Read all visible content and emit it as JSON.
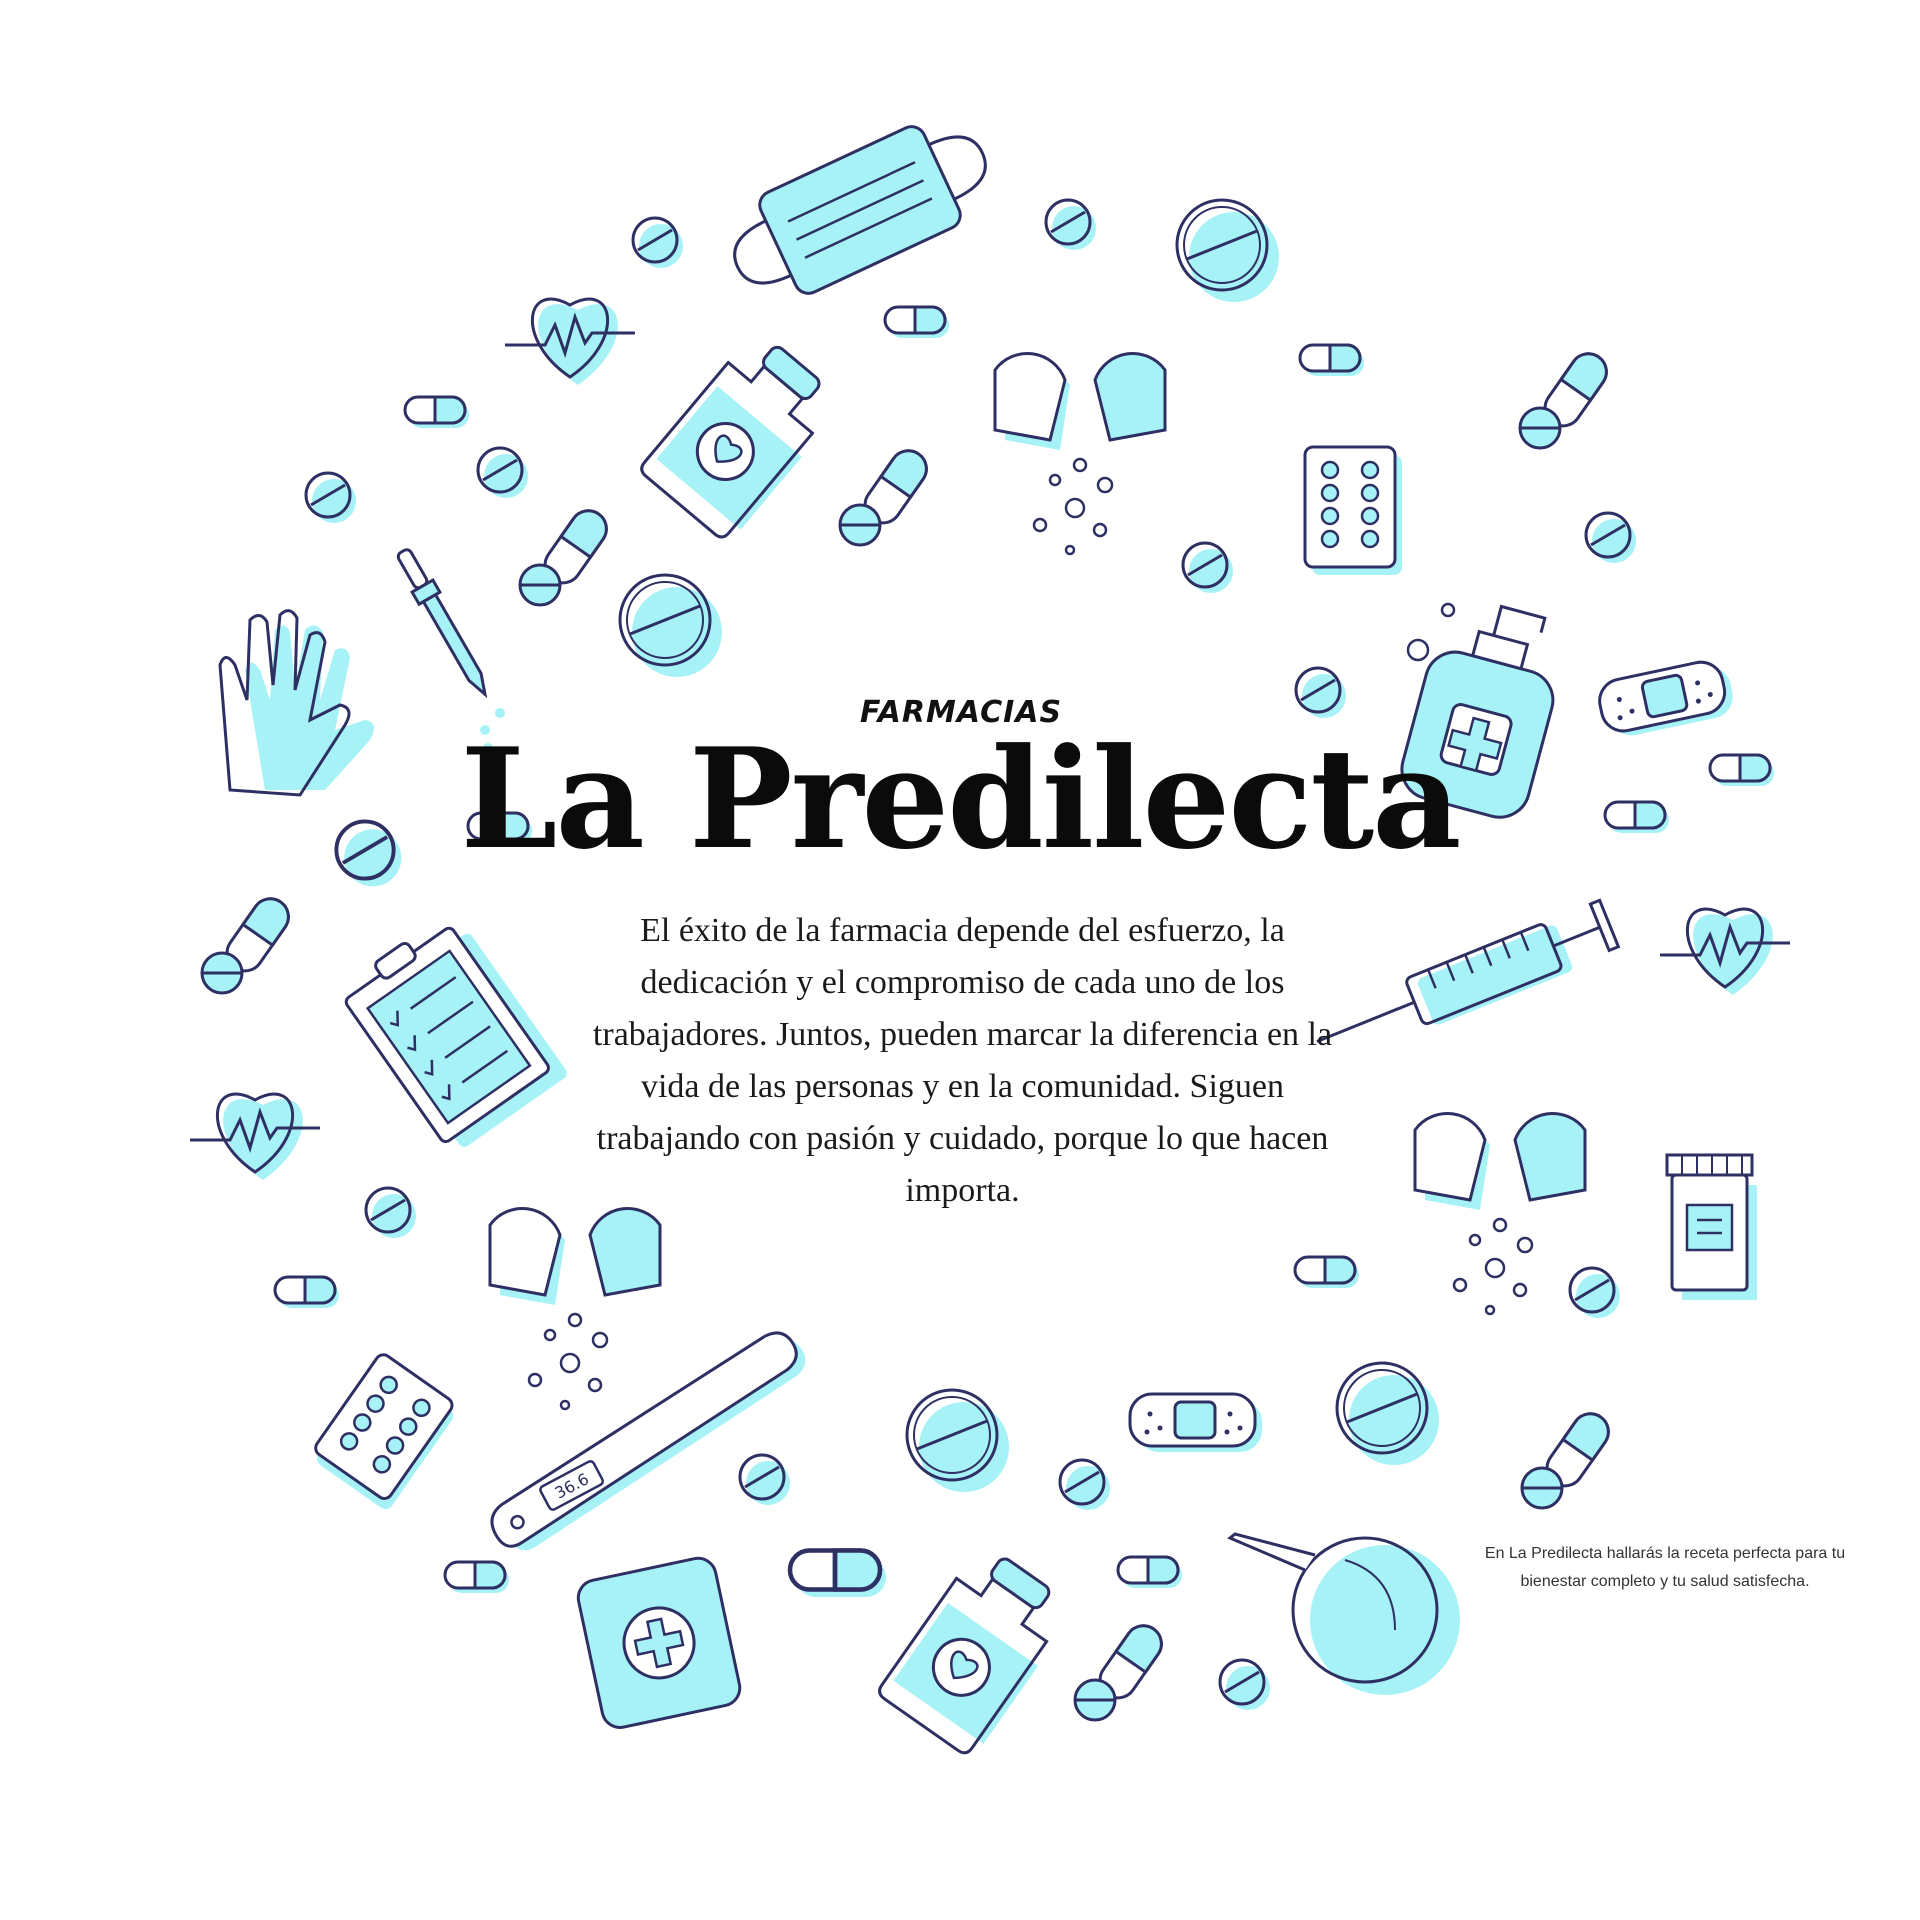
{
  "header": {
    "eyebrow": "FARMACIAS",
    "title": "La Predilecta"
  },
  "main": {
    "paragraph": "El éxito de la farmacia depende del esfuerzo, la dedicación y el compromiso de cada uno de los trabajadores. Juntos, pueden marcar la diferencia en la vida de las personas y en la comunidad. Siguen trabajando con pasión y cuidado, porque lo que hacen importa."
  },
  "footer": {
    "note": "En La Predilecta hallarás la receta perfecta para tu bienestar completo y tu salud satisfecha."
  },
  "illustration": {
    "thermometer_reading": "36.6",
    "icons": [
      "face-mask-icon",
      "heart-rate-icon",
      "medicine-bottle-icon",
      "open-capsule-icon",
      "blister-pack-icon",
      "capsule-icon",
      "tablet-icon",
      "dropper-icon",
      "gloves-icon",
      "hand-sanitizer-icon",
      "bandage-icon",
      "clipboard-icon",
      "syringe-icon",
      "pill-jar-icon",
      "thermometer-icon",
      "first-aid-kit-icon",
      "enema-bulb-icon"
    ]
  },
  "colors": {
    "accent_fill": "#a6f2f6",
    "outline": "#2e2f62",
    "text": "#111111"
  }
}
